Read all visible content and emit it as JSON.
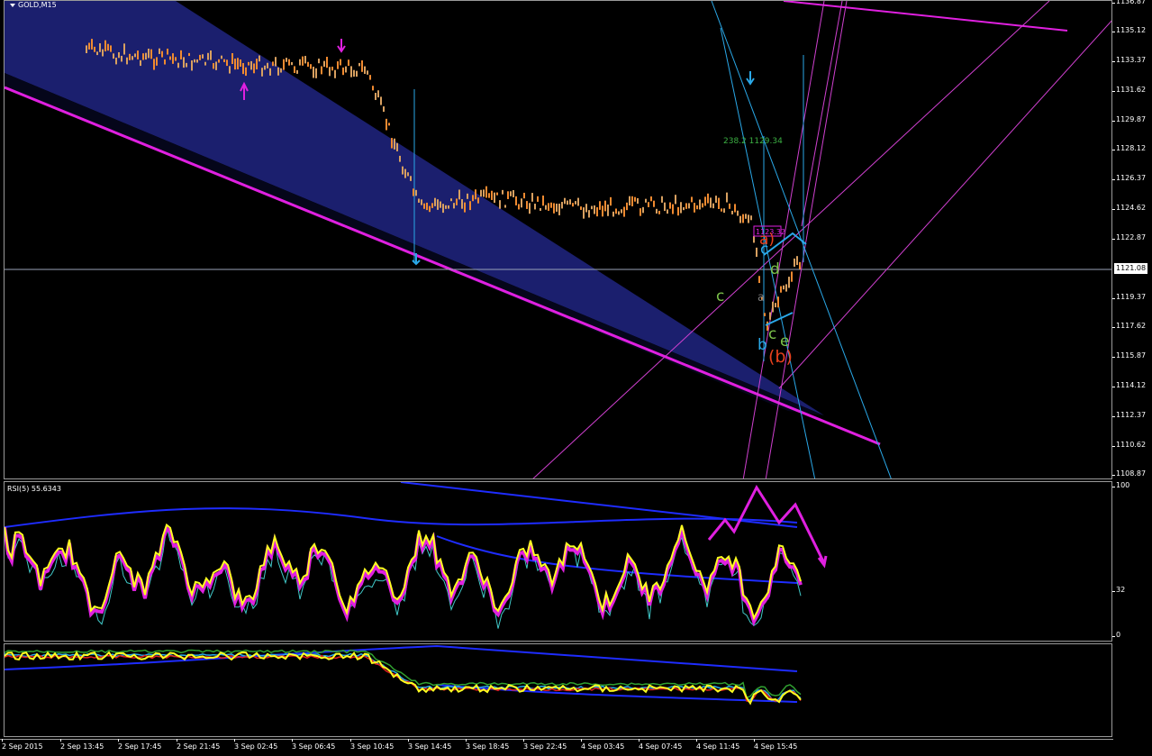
{
  "symbol": {
    "label": "GOLD,M15"
  },
  "price_axis": {
    "ticks": [
      "1136.87",
      "1135.12",
      "1133.37",
      "1131.62",
      "1129.87",
      "1128.12",
      "1126.37",
      "1124.62",
      "1122.87",
      "1121.08",
      "1119.37",
      "1117.62",
      "1115.87",
      "1114.12",
      "1112.37",
      "1110.62",
      "1108.87"
    ],
    "current_price": "1121.08"
  },
  "rsi": {
    "label": "RSI(5) 55.6343",
    "scale": [
      "100",
      "32",
      "0"
    ]
  },
  "time_axis": {
    "ticks": [
      "2 Sep 2015",
      "2 Sep 13:45",
      "2 Sep 17:45",
      "2 Sep 21:45",
      "3 Sep 02:45",
      "3 Sep 06:45",
      "3 Sep 10:45",
      "3 Sep 14:45",
      "3 Sep 18:45",
      "3 Sep 22:45",
      "4 Sep 03:45",
      "4 Sep 07:45",
      "4 Sep 11:45",
      "4 Sep 15:45"
    ]
  },
  "annotations": {
    "fib_label": "238.2 1129.34",
    "box_label": "1123.32",
    "wave_a_paren": "a)",
    "wave_c_upper": "c",
    "wave_d": "d",
    "wave_c_left": "c",
    "wave_a_small": "a",
    "wave_b": "b",
    "wave_c_low": "c",
    "wave_e": "e",
    "wave_b_paren": "(b)"
  },
  "colors": {
    "channel_fill": "#1b1f6e",
    "magenta": "#e020e0",
    "light_blue": "#2aa8e8",
    "candle": "#f08a30",
    "rsi_main": "#ffff20",
    "rsi_envelope": "#1e2cff"
  }
}
